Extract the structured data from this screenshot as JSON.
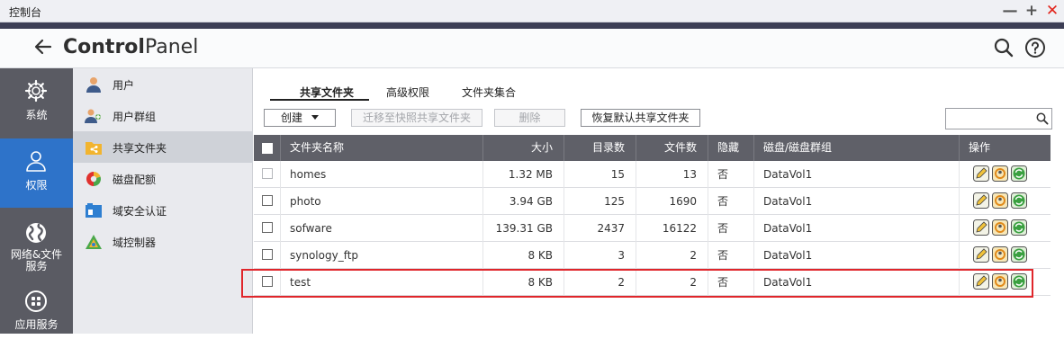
{
  "window": {
    "title": "控制台",
    "min": "—",
    "max": "+",
    "close": "✕"
  },
  "header": {
    "title_bold": "Control",
    "title_rest": "Panel",
    "back_icon": "arrow-left-icon",
    "search_icon": "search-icon",
    "help_icon": "help-icon"
  },
  "rail": [
    {
      "label": "系统",
      "icon": "gear-icon",
      "active": false
    },
    {
      "label": "权限",
      "icon": "user-icon",
      "active": true
    },
    {
      "label": "网络&文件服务",
      "label_line1": "网络&文件",
      "label_line2": "服务",
      "icon": "globe-icon",
      "active": false
    },
    {
      "label": "应用服务",
      "icon": "apps-grid-icon",
      "active": false
    }
  ],
  "submenu": [
    {
      "label": "用户",
      "icon": "user-icon"
    },
    {
      "label": "用户群组",
      "icon": "user-group-icon"
    },
    {
      "label": "共享文件夹",
      "icon": "shared-folder-icon",
      "active": true
    },
    {
      "label": "磁盘配额",
      "icon": "disk-quota-icon"
    },
    {
      "label": "域安全认证",
      "icon": "domain-security-icon"
    },
    {
      "label": "域控制器",
      "icon": "domain-controller-icon"
    }
  ],
  "tabs": [
    {
      "label": "共享文件夹",
      "active": true
    },
    {
      "label": "高级权限"
    },
    {
      "label": "文件夹集合"
    }
  ],
  "toolbar": {
    "create_label": "创建",
    "migrate_label": "迁移至快照共享文件夹",
    "delete_label": "删除",
    "restore_label": "恢复默认共享文件夹",
    "search_placeholder": ""
  },
  "table": {
    "columns": [
      "文件夹名称",
      "大小",
      "目录数",
      "文件数",
      "隐藏",
      "磁盘/磁盘群组",
      "操作"
    ],
    "rows": [
      {
        "name": "homes",
        "size": "1.32 MB",
        "dirs": "15",
        "files": "13",
        "hidden": "否",
        "volume": "DataVol1"
      },
      {
        "name": "photo",
        "size": "3.94 GB",
        "dirs": "125",
        "files": "1690",
        "hidden": "否",
        "volume": "DataVol1"
      },
      {
        "name": "sofware",
        "size": "139.31 GB",
        "dirs": "2437",
        "files": "16122",
        "hidden": "否",
        "volume": "DataVol1"
      },
      {
        "name": "synology_ftp",
        "size": "8 KB",
        "dirs": "3",
        "files": "2",
        "hidden": "否",
        "volume": "DataVol1"
      },
      {
        "name": "test",
        "size": "8 KB",
        "dirs": "2",
        "files": "2",
        "hidden": "否",
        "volume": "DataVol1"
      }
    ],
    "action_icons": [
      "edit-properties-icon",
      "edit-permissions-icon",
      "refresh-icon"
    ]
  },
  "colors": {
    "accent": "#2e73c9",
    "rail_bg": "#5a5b63",
    "table_header": "#5f6068",
    "highlight": "#e0262b"
  }
}
